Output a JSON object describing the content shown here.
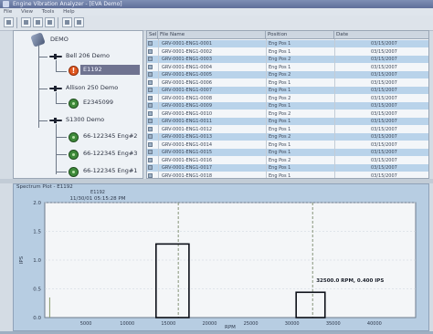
{
  "window": {
    "title": "Engine Vibration Analyzer - [EVA Demo]"
  },
  "menu": [
    "File",
    "View",
    "Tools",
    "Help"
  ],
  "tree": {
    "root": "DEMO",
    "nodes": [
      {
        "label": "Bell 206 Demo",
        "kind": "aircraft"
      },
      {
        "label": "E1192",
        "kind": "alert"
      },
      {
        "label": "Allison 250 Demo",
        "kind": "aircraft"
      },
      {
        "label": "E2345099",
        "kind": "engine"
      },
      {
        "label": "S1300 Demo",
        "kind": "aircraft"
      },
      {
        "label": "66-122345 Eng#2",
        "kind": "engine"
      },
      {
        "label": "66-122345 Eng#3",
        "kind": "engine"
      },
      {
        "label": "66-122345 Eng#1",
        "kind": "engine"
      }
    ]
  },
  "table": {
    "columns": [
      "Sel",
      "File Name",
      "Position",
      "Date"
    ],
    "rows": [
      [
        "",
        "GRV-0001-ENG1-0001",
        "Eng Pos 1",
        "03/15/2007"
      ],
      [
        "",
        "GRV-0001-ENG1-0002",
        "Eng Pos 1",
        "03/15/2007"
      ],
      [
        "",
        "GRV-0001-ENG1-0003",
        "Eng Pos 2",
        "03/15/2007"
      ],
      [
        "",
        "GRV-0001-ENG1-0004",
        "Eng Pos 1",
        "03/15/2007"
      ],
      [
        "",
        "GRV-0001-ENG1-0005",
        "Eng Pos 2",
        "03/15/2007"
      ],
      [
        "",
        "GRV-0001-ENG1-0006",
        "Eng Pos 1",
        "03/15/2007"
      ],
      [
        "",
        "GRV-0001-ENG1-0007",
        "Eng Pos 1",
        "03/15/2007"
      ],
      [
        "",
        "GRV-0001-ENG1-0008",
        "Eng Pos 2",
        "03/15/2007"
      ],
      [
        "",
        "GRV-0001-ENG1-0009",
        "Eng Pos 1",
        "03/15/2007"
      ],
      [
        "",
        "GRV-0001-ENG1-0010",
        "Eng Pos 2",
        "03/15/2007"
      ],
      [
        "",
        "GRV-0001-ENG1-0011",
        "Eng Pos 1",
        "03/15/2007"
      ],
      [
        "",
        "GRV-0001-ENG1-0012",
        "Eng Pos 1",
        "03/15/2007"
      ],
      [
        "",
        "GRV-0001-ENG1-0013",
        "Eng Pos 2",
        "03/15/2007"
      ],
      [
        "",
        "GRV-0001-ENG1-0014",
        "Eng Pos 1",
        "03/15/2007"
      ],
      [
        "",
        "GRV-0001-ENG1-0015",
        "Eng Pos 1",
        "03/15/2007"
      ],
      [
        "",
        "GRV-0001-ENG1-0016",
        "Eng Pos 2",
        "03/15/2007"
      ],
      [
        "",
        "GRV-0001-ENG1-0017",
        "Eng Pos 1",
        "03/15/2007"
      ],
      [
        "",
        "GRV-0001-ENG1-0018",
        "Eng Pos 1",
        "03/15/2007"
      ]
    ]
  },
  "chart_panel": {
    "title": "Spectrum Plot - E1192"
  },
  "chart_data": {
    "type": "bar",
    "subtitle_top": "E1192",
    "subtitle": "11/30/01 05:15:28 PM",
    "xlabel": "RPM",
    "ylabel": "IPS",
    "xlim": [
      0,
      45000
    ],
    "ylim": [
      0,
      2.0
    ],
    "x_ticks": [
      "5000",
      "10000",
      "15000",
      "20000",
      "25000",
      "30000",
      "35000",
      "40000"
    ],
    "y_ticks": [
      "0.0",
      "0.5",
      "1.0",
      "1.5",
      "2.0"
    ],
    "boxes": [
      {
        "x0": 13500,
        "x1": 17500,
        "value": 1.28
      },
      {
        "x0": 30500,
        "x1": 34000,
        "value": 0.44
      }
    ],
    "cursor_lines": [
      16200,
      32500
    ],
    "noise_spike": {
      "x": 600,
      "value": 0.35
    },
    "annotation": "32500.0 RPM, 0.400 IPS",
    "colors": {
      "plot_bg": "#f4f6f8",
      "box": "#0c0f18",
      "cursor": "#7a8a6c"
    }
  }
}
